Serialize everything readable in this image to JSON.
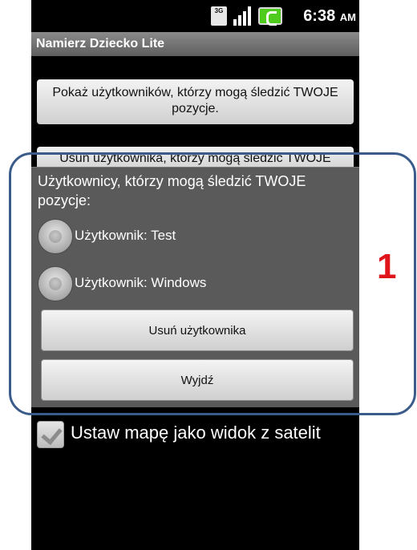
{
  "statusbar": {
    "network_label": "3G",
    "time": "6:38",
    "ampm": "AM",
    "signal_icon": "signal-bars-icon",
    "battery_icon": "battery-charging-icon",
    "battery_color": "#4ecb1c"
  },
  "app": {
    "title": "Namierz Dziecko Lite"
  },
  "main": {
    "show_users_button": "Pokaż użytkowników, którzy mogą śledzić TWOJE pozycje.",
    "remove_user_button": "Usuń użytkownika, którzy mogą śledzić TWOJE",
    "satellite_checkbox_label": "Ustaw mapę jako widok z satelit",
    "satellite_checked": true
  },
  "dialog": {
    "title": "Użytkownicy, którzy mogą śledzić TWOJE pozycje:",
    "options": [
      {
        "label": "Użytkownik: Test",
        "selected": false
      },
      {
        "label": "Użytkownik: Windows",
        "selected": false
      }
    ],
    "remove_button": "Usuń użytkownika",
    "exit_button": "Wyjdź"
  },
  "annotation": {
    "marker_text": "1",
    "marker_color": "#e0151b",
    "outline_color": "#3b5c8a"
  }
}
